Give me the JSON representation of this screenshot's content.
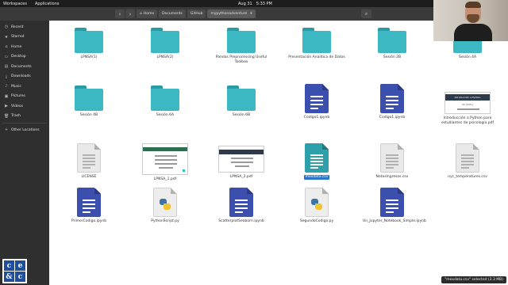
{
  "topbar": {
    "workspaces": "Workspaces",
    "applications": "Applications",
    "date": "Aug 31",
    "time": "5:33 PM",
    "power_icon": "power-icon"
  },
  "header": {
    "back_icon": "chevron-left-icon",
    "forward_icon": "chevron-right-icon",
    "breadcrumbs": [
      "Home",
      "Documents",
      "GitHub",
      "mypythonadventure"
    ],
    "dropdown_icon": "chevron-down-icon",
    "search_icon": "search-icon",
    "view_icon": "list-icon",
    "menu_icon": "hamburger-icon"
  },
  "sidebar": {
    "items": [
      {
        "label": "Recent",
        "icon": "clock-icon"
      },
      {
        "label": "Starred",
        "icon": "star-icon"
      },
      {
        "label": "Home",
        "icon": "home-icon"
      },
      {
        "label": "Desktop",
        "icon": "desktop-icon"
      },
      {
        "label": "Documents",
        "icon": "document-icon"
      },
      {
        "label": "Downloads",
        "icon": "download-icon"
      },
      {
        "label": "Music",
        "icon": "music-icon"
      },
      {
        "label": "Pictures",
        "icon": "picture-icon"
      },
      {
        "label": "Videos",
        "icon": "video-icon"
      },
      {
        "label": "Trash",
        "icon": "trash-icon"
      },
      {
        "label": "Other Locations",
        "icon": "plus-icon"
      }
    ]
  },
  "logo": {
    "letters": [
      "c",
      "e",
      "&",
      "c"
    ]
  },
  "files": [
    {
      "name": "LPNSA(1)",
      "kind": "folder"
    },
    {
      "name": "LPNSA(2)",
      "kind": "folder"
    },
    {
      "name": "Pandas Preprocessing Useful Toolbox",
      "kind": "folder"
    },
    {
      "name": "Presentación Analítica de Datos",
      "kind": "folder"
    },
    {
      "name": "Sesión 2B",
      "kind": "folder"
    },
    {
      "name": "Sesión 4A",
      "kind": "folder"
    },
    {
      "name": "Sesión 4B",
      "kind": "folder"
    },
    {
      "name": "Sesión 6A",
      "kind": "folder"
    },
    {
      "name": "Sesión 6B",
      "kind": "folder"
    },
    {
      "name": "Codigo1.ipynb",
      "kind": "notebook"
    },
    {
      "name": "Codigo1.ipynb",
      "kind": "notebook"
    },
    {
      "name": "Introducción a Python para estudiantes de psicología.pdf",
      "kind": "pdf"
    },
    {
      "name": "LICENSE",
      "kind": "text"
    },
    {
      "name": "LPNSA_1.pdf",
      "kind": "pdf"
    },
    {
      "name": "LPNSA_2.pdf",
      "kind": "pdf"
    },
    {
      "name": "mexdata.csv",
      "kind": "csv-selected"
    },
    {
      "name": "NotasIngresos.csv",
      "kind": "text"
    },
    {
      "name": "nyc_temperatures.csv",
      "kind": "text"
    },
    {
      "name": "PrimerCodigo.ipynb",
      "kind": "notebook"
    },
    {
      "name": "PythonScript.py",
      "kind": "python"
    },
    {
      "name": "ScatterplotSeaborn.ipynb",
      "kind": "notebook"
    },
    {
      "name": "SegundoCodigo.py",
      "kind": "python"
    },
    {
      "name": "Un_Jupyter_Notebook_Simple.ipynb",
      "kind": "notebook"
    }
  ],
  "pdf_thumbs": {
    "intro_title": "Introducción a Python",
    "intro_pct": "20 (50%)"
  },
  "status": "\"mexdata.csv\" selected (3.3 MB)",
  "colors": {
    "folder": "#3cb8c3",
    "notebook": "#3a4fae",
    "selection": "#2a76c6",
    "sidebar": "#2f2f2f",
    "header": "#3a3a3a"
  }
}
